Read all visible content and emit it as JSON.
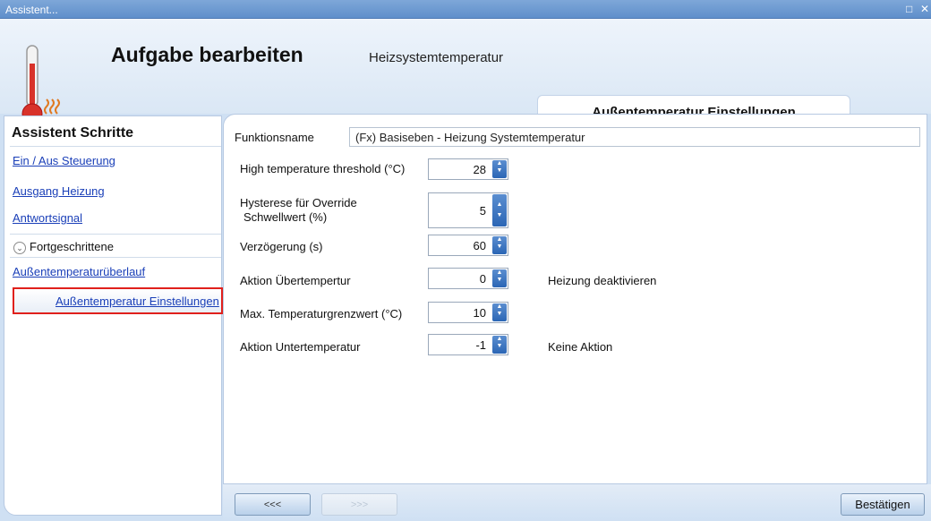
{
  "window": {
    "title": "Assistent...",
    "controls": [
      "□",
      "✕"
    ]
  },
  "header": {
    "title": "Aufgabe bearbeiten",
    "subtitle": "Heizsystemtemperatur",
    "tab": "Außentemperatur Einstellungen",
    "icon": "thermometer-heating-icon"
  },
  "sidebar": {
    "title": "Assistent Schritte",
    "items": [
      "Ein / Aus Steuerung",
      "Ausgang Heizung",
      "Antwortsignal"
    ],
    "advanced_label": "Fortgeschrittene",
    "advanced_items": [
      "Außentemperaturüberlauf"
    ],
    "selected_item": "Außentemperatur Einstellungen"
  },
  "form": {
    "function_name_label": "Funktionsname",
    "function_name_value": "(Fx) Basiseben - Heizung Systemtemperatur",
    "fields": [
      {
        "label": "High temperature threshold (°C)",
        "value": "28",
        "note": ""
      },
      {
        "label": "Hysterese für Override",
        "label2": "Schwellwert (%)",
        "value": "5",
        "note": ""
      },
      {
        "label": "Verzögerung (s)",
        "value": "60",
        "note": ""
      },
      {
        "label": "Aktion Übertempertur",
        "value": "0",
        "note": "Heizung deaktivieren"
      },
      {
        "label": "Max. Temperaturgrenzwert (°C)",
        "value": "10",
        "note": ""
      },
      {
        "label": "Aktion Untertemperatur",
        "value": "-1",
        "note": "Keine Aktion"
      }
    ]
  },
  "footer": {
    "back_label": "<<<",
    "next_label": ">>>",
    "confirm_label": "Bestätigen"
  },
  "colors": {
    "accent": "#2b66b5",
    "link": "#1a3fb8",
    "highlight_border": "#e0201c"
  }
}
